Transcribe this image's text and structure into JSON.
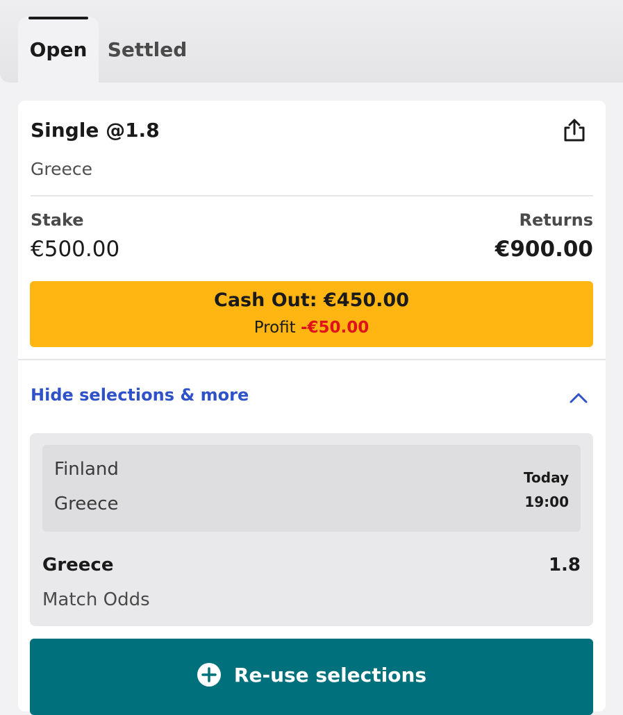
{
  "tabs": {
    "open": "Open",
    "settled": "Settled",
    "active": "Open"
  },
  "bet": {
    "title": "Single @1.8",
    "subtitle": "Greece",
    "stake_label": "Stake",
    "stake_value": "€500.00",
    "returns_label": "Returns",
    "returns_value": "€900.00",
    "share_icon": "share-icon"
  },
  "cashout": {
    "label": "Cash Out: €450.00",
    "profit_label": "Profit",
    "profit_value": "-€50.00"
  },
  "selections_toggle": {
    "label": "Hide selections & more",
    "icon": "chevron-up-icon"
  },
  "selection": {
    "home_team": "Finland",
    "away_team": "Greece",
    "day": "Today",
    "time": "19:00",
    "pick": "Greece",
    "odds": "1.8",
    "market": "Match Odds"
  },
  "reuse_button": {
    "label": "Re-use selections",
    "icon": "plus-circle-icon"
  },
  "colors": {
    "cashout_bg": "#ffb612",
    "profit_negative": "#e0111b",
    "link_blue": "#2f52c9",
    "reuse_bg": "#00717c"
  }
}
